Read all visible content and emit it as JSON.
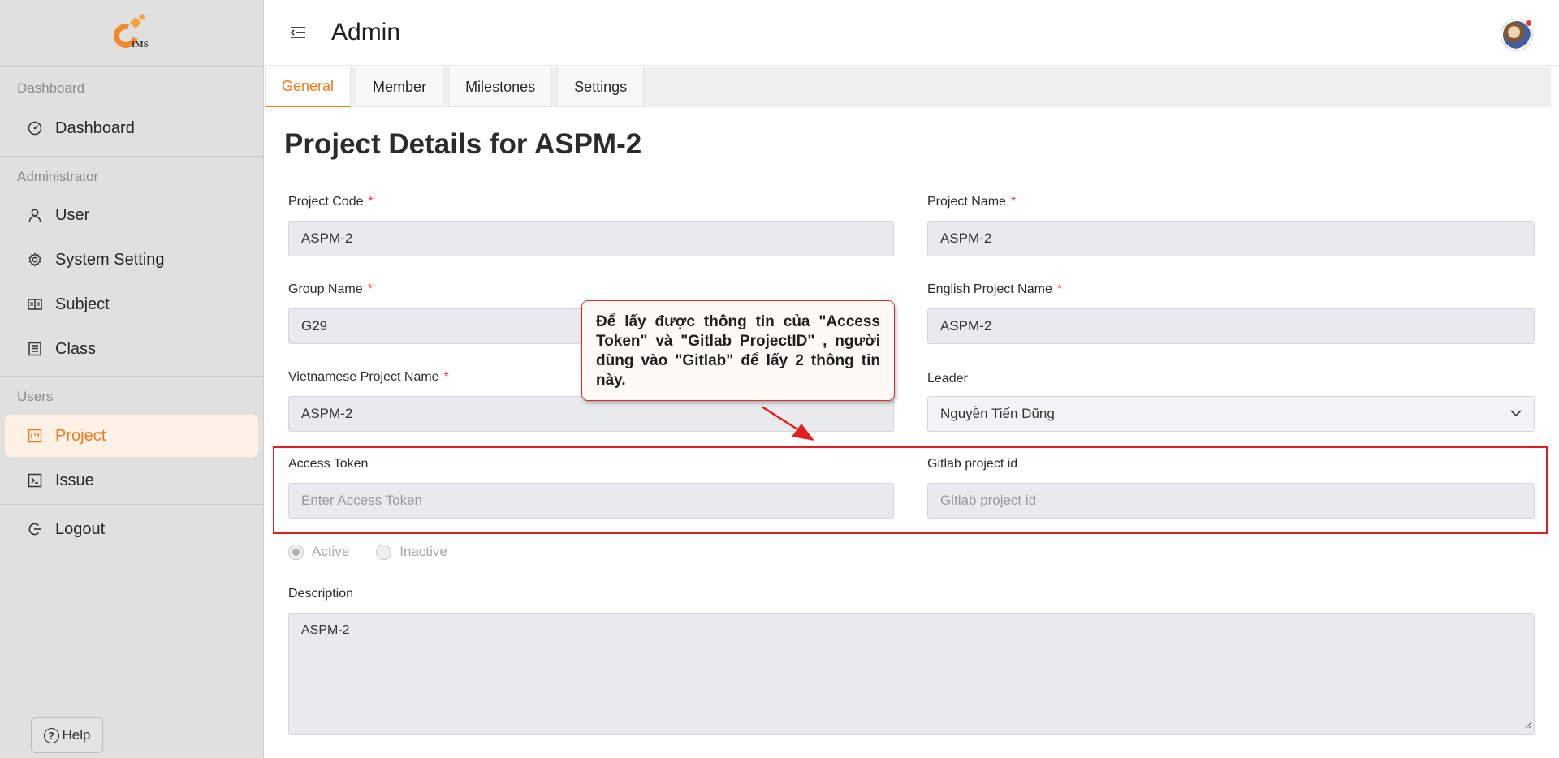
{
  "sidebar": {
    "logo_text": "IMS",
    "sections": [
      {
        "label": "Dashboard",
        "items": [
          {
            "label": "Dashboard",
            "icon": "dashboard-icon"
          }
        ]
      },
      {
        "label": "Administrator",
        "items": [
          {
            "label": "User",
            "icon": "user-icon"
          },
          {
            "label": "System Setting",
            "icon": "gear-icon"
          },
          {
            "label": "Subject",
            "icon": "book-icon"
          },
          {
            "label": "Class",
            "icon": "building-icon"
          }
        ]
      },
      {
        "label": "Users",
        "items": [
          {
            "label": "Project",
            "icon": "project-icon",
            "active": true
          },
          {
            "label": "Issue",
            "icon": "terminal-icon"
          }
        ]
      }
    ],
    "logout_label": "Logout",
    "help_label": "Help"
  },
  "header": {
    "title": "Admin"
  },
  "tabs": [
    {
      "label": "General",
      "active": true
    },
    {
      "label": "Member"
    },
    {
      "label": "Milestones"
    },
    {
      "label": "Settings"
    }
  ],
  "page": {
    "title": "Project Details for ASPM-2",
    "fields": {
      "project_code": {
        "label": "Project Code",
        "value": "ASPM-2"
      },
      "project_name": {
        "label": "Project Name",
        "value": "ASPM-2"
      },
      "group_name": {
        "label": "Group Name",
        "value": "G29"
      },
      "english_project_name": {
        "label": "English Project Name",
        "value": "ASPM-2"
      },
      "vietnamese_project_name": {
        "label": "Vietnamese Project Name",
        "value": "ASPM-2"
      },
      "leader": {
        "label": "Leader",
        "value": "Nguyễn Tiến Dũng"
      },
      "access_token": {
        "label": "Access Token",
        "placeholder": "Enter Access Token"
      },
      "gitlab_project_id": {
        "label": "Gitlab project id",
        "placeholder": "Gitlab project id"
      },
      "description": {
        "label": "Description",
        "value": "ASPM-2"
      }
    },
    "status": {
      "active_label": "Active",
      "inactive_label": "Inactive",
      "selected": "Active"
    }
  },
  "callout": {
    "text": "Để lấy được thông tin của \"Access Token\" và \"Gitlab ProjectID\" , người dùng vào \"Gitlab\" để lấy 2 thông tin này."
  },
  "colors": {
    "accent": "#f07a1e",
    "annotation_red": "#e02020"
  }
}
